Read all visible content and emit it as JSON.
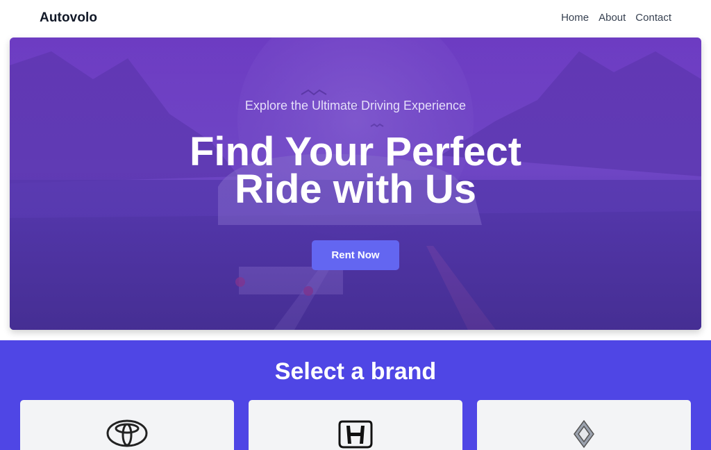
{
  "nav": {
    "brand": "Autovolo",
    "links": [
      "Home",
      "About",
      "Contact"
    ]
  },
  "hero": {
    "kicker": "Explore the Ultimate Driving Experience",
    "title_line1": "Find Your Perfect",
    "title_line2": "Ride with Us",
    "cta": "Rent Now"
  },
  "brands": {
    "title": "Select a brand",
    "items": [
      {
        "icon": "toyota-logo-icon"
      },
      {
        "icon": "honda-logo-icon"
      },
      {
        "icon": "renault-logo-icon"
      }
    ]
  },
  "colors": {
    "accent": "#6366f1",
    "brand_section": "#4f46e5",
    "hero_tint": "#6232be"
  }
}
